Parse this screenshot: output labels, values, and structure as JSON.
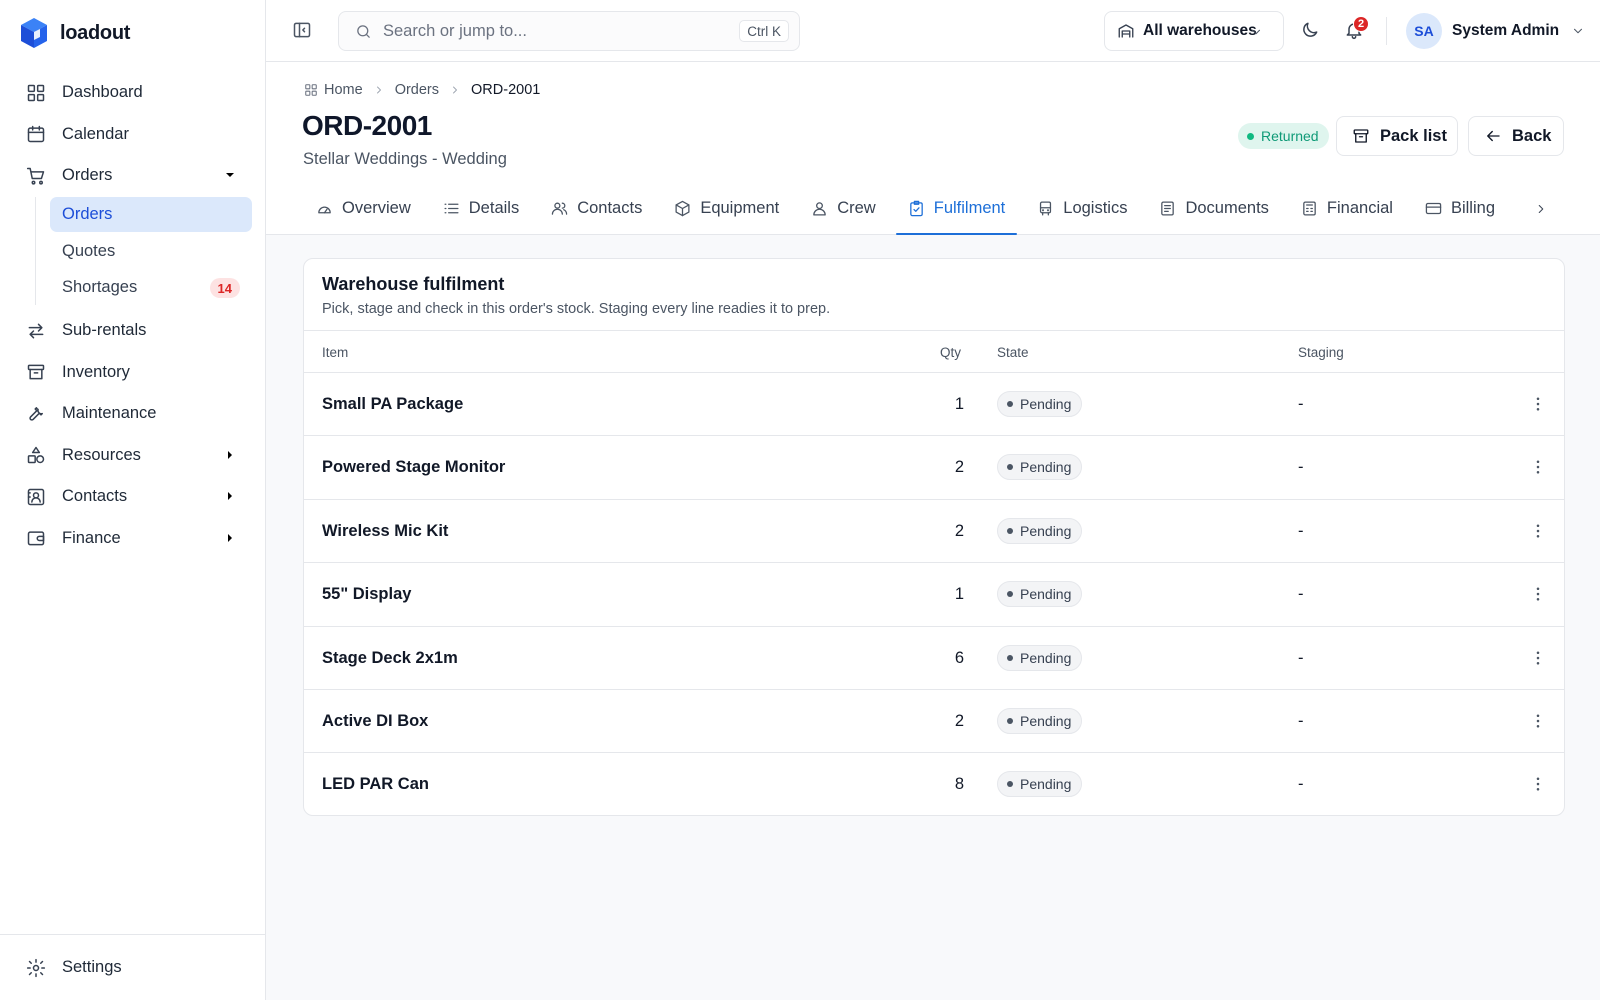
{
  "brand": {
    "name": "loadout"
  },
  "sidebar": {
    "items": [
      {
        "label": "Dashboard",
        "icon": "dashboard-icon"
      },
      {
        "label": "Calendar",
        "icon": "calendar-icon"
      },
      {
        "label": "Orders",
        "icon": "cart-icon",
        "expanded": true,
        "children": [
          {
            "label": "Orders",
            "active": true
          },
          {
            "label": "Quotes"
          },
          {
            "label": "Shortages",
            "badge": "14"
          }
        ]
      },
      {
        "label": "Sub-rentals",
        "icon": "swap-icon"
      },
      {
        "label": "Inventory",
        "icon": "archive-icon"
      },
      {
        "label": "Maintenance",
        "icon": "wrench-icon"
      },
      {
        "label": "Resources",
        "icon": "shapes-icon"
      },
      {
        "label": "Contacts",
        "icon": "contact-card-icon"
      },
      {
        "label": "Finance",
        "icon": "wallet-icon"
      }
    ],
    "footer": {
      "label": "Settings",
      "icon": "gear-icon"
    }
  },
  "topbar": {
    "search": {
      "placeholder": "Search or jump to...",
      "shortcut": "Ctrl K",
      "value": ""
    },
    "warehouse": {
      "label": "All warehouses"
    },
    "notifications": {
      "count": "2"
    },
    "user": {
      "initials": "SA",
      "name": "System Admin"
    }
  },
  "breadcrumb": {
    "home": "Home",
    "section": "Orders",
    "current": "ORD-2001"
  },
  "order": {
    "title": "ORD-2001",
    "subtitle": "Stellar Weddings - Wedding",
    "status": "Returned",
    "status_color": "#10b981"
  },
  "actions": {
    "pack_list": "Pack list",
    "back": "Back"
  },
  "tabs": [
    {
      "label": "Overview",
      "icon": "gauge-icon"
    },
    {
      "label": "Details",
      "icon": "list-icon"
    },
    {
      "label": "Contacts",
      "icon": "users-icon"
    },
    {
      "label": "Equipment",
      "icon": "box-icon"
    },
    {
      "label": "Crew",
      "icon": "user-icon"
    },
    {
      "label": "Fulfilment",
      "icon": "clipboard-check-icon",
      "active": true
    },
    {
      "label": "Logistics",
      "icon": "bus-icon"
    },
    {
      "label": "Documents",
      "icon": "document-icon"
    },
    {
      "label": "Financial",
      "icon": "calculator-icon"
    },
    {
      "label": "Billing",
      "icon": "credit-card-icon"
    }
  ],
  "fulfilment": {
    "title": "Warehouse fulfilment",
    "description": "Pick, stage and check in this order's stock. Staging every line readies it to prep.",
    "columns": {
      "item": "Item",
      "qty": "Qty",
      "state": "State",
      "staging": "Staging"
    },
    "rows": [
      {
        "item": "Small PA Package",
        "qty": "1",
        "state": "Pending",
        "staging": "-"
      },
      {
        "item": "Powered Stage Monitor",
        "qty": "2",
        "state": "Pending",
        "staging": "-"
      },
      {
        "item": "Wireless Mic Kit",
        "qty": "2",
        "state": "Pending",
        "staging": "-"
      },
      {
        "item": "55\" Display",
        "qty": "1",
        "state": "Pending",
        "staging": "-"
      },
      {
        "item": "Stage Deck 2x1m",
        "qty": "6",
        "state": "Pending",
        "staging": "-"
      },
      {
        "item": "Active DI Box",
        "qty": "2",
        "state": "Pending",
        "staging": "-"
      },
      {
        "item": "LED PAR Can",
        "qty": "8",
        "state": "Pending",
        "staging": "-"
      }
    ]
  },
  "colors": {
    "accent": "#1d6fd8",
    "active_bg": "#dbe8fb",
    "danger": "#dc2626",
    "success": "#10b981"
  }
}
